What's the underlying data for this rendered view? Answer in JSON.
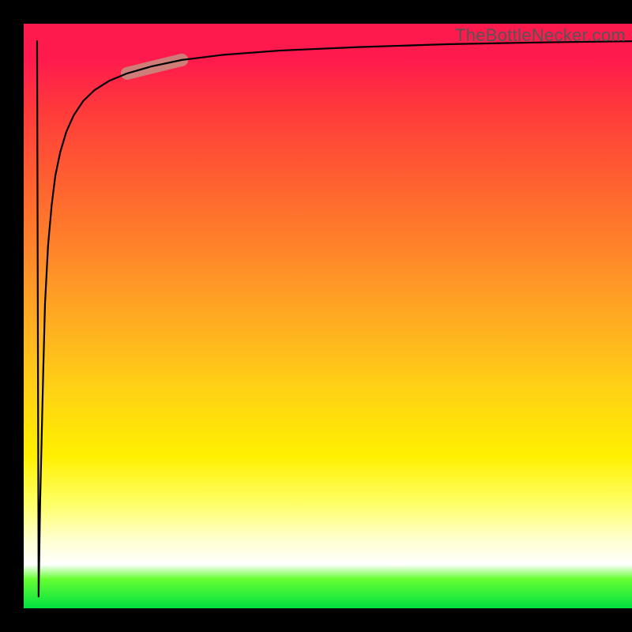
{
  "watermark": "TheBottleNecker.com",
  "chart_data": {
    "type": "line",
    "title": "",
    "xlabel": "",
    "ylabel": "",
    "xlim": [
      0,
      100
    ],
    "ylim": [
      0,
      100
    ],
    "x": [
      2.2,
      2.7,
      3.2,
      3.5,
      4.0,
      4.6,
      5.2,
      6.0,
      7.0,
      8.2,
      9.8,
      11.6,
      14.0,
      17.0,
      21.0,
      26.0,
      33.0,
      42.0,
      55.0,
      70.0,
      85.0,
      100.0
    ],
    "values": [
      2.0,
      18.0,
      40.0,
      52.0,
      62.0,
      69.0,
      74.0,
      78.0,
      81.5,
      84.3,
      86.8,
      88.6,
      90.2,
      91.5,
      92.7,
      93.8,
      94.7,
      95.4,
      96.0,
      96.5,
      96.8,
      97.0
    ],
    "highlight_segment": {
      "x": [
        17.0,
        26.0
      ],
      "values": [
        91.5,
        93.8
      ]
    },
    "background_gradient_stops": [
      {
        "pos": 0.0,
        "color": "#ff1a4d"
      },
      {
        "pos": 0.06,
        "color": "#ff1a4d"
      },
      {
        "pos": 0.15,
        "color": "#ff3b3b"
      },
      {
        "pos": 0.3,
        "color": "#ff6a2e"
      },
      {
        "pos": 0.42,
        "color": "#ff8f28"
      },
      {
        "pos": 0.52,
        "color": "#ffb020"
      },
      {
        "pos": 0.62,
        "color": "#ffd015"
      },
      {
        "pos": 0.74,
        "color": "#fff000"
      },
      {
        "pos": 0.82,
        "color": "#ffff66"
      },
      {
        "pos": 0.88,
        "color": "#ffffcc"
      },
      {
        "pos": 0.925,
        "color": "#ffffff"
      },
      {
        "pos": 0.95,
        "color": "#66ff33"
      },
      {
        "pos": 1.0,
        "color": "#00e040"
      }
    ]
  }
}
